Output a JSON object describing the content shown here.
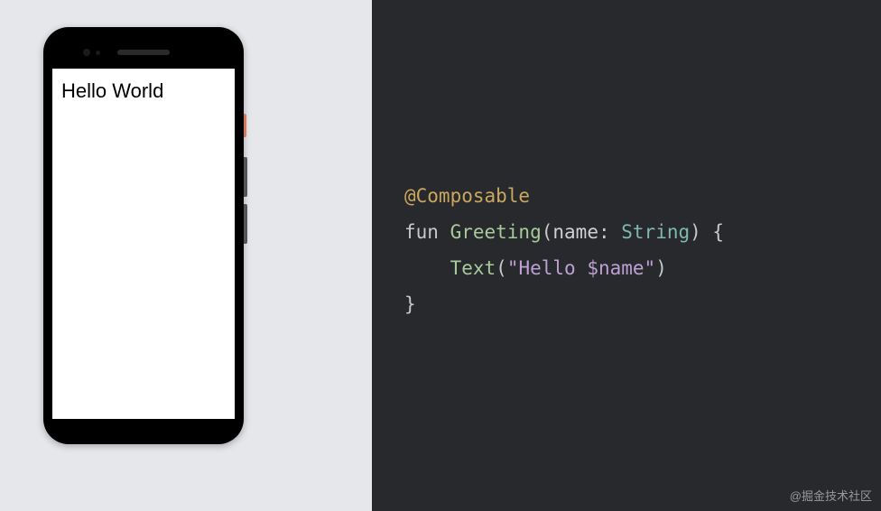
{
  "phone": {
    "screen_text": "Hello World"
  },
  "code": {
    "annotation": "@Composable",
    "keyword_fun": "fun ",
    "fn_name": "Greeting",
    "paren_open": "(",
    "param_name": "name",
    "colon": ": ",
    "type": "String",
    "paren_close": ") {",
    "indent": "    ",
    "call_name": "Text",
    "call_open": "(",
    "string_literal": "\"Hello $name\"",
    "call_close": ")",
    "brace_close": "}"
  },
  "watermark": "@掘金技术社区"
}
